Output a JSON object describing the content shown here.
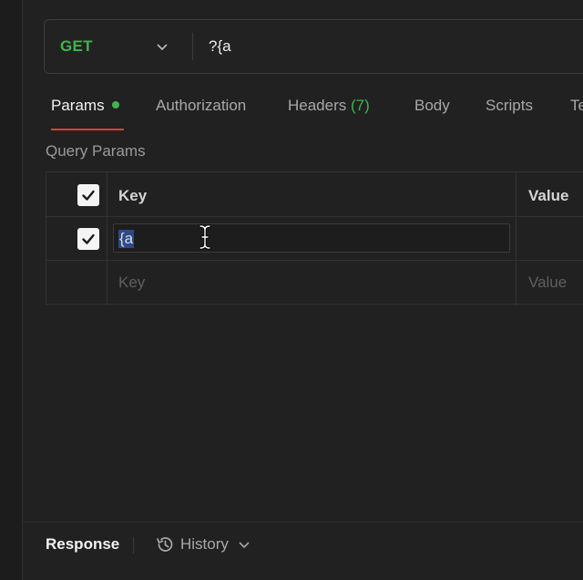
{
  "request": {
    "method": "GET",
    "url": "?{a"
  },
  "tabs": [
    {
      "label": "Params"
    },
    {
      "label": "Authorization"
    },
    {
      "label": "Headers",
      "count": "(7)"
    },
    {
      "label": "Body"
    },
    {
      "label": "Scripts"
    },
    {
      "label": "Te"
    }
  ],
  "query_params": {
    "title": "Query Params",
    "header": {
      "key": "Key",
      "value": "Value"
    },
    "rows": [
      {
        "checked": true,
        "key": "{a",
        "value": ""
      }
    ],
    "new_row": {
      "key_placeholder": "Key",
      "value_placeholder": "Value"
    }
  },
  "bottom": {
    "response_label": "Response",
    "history_label": "History"
  },
  "colors": {
    "accent_green": "#3fb54d",
    "active_tab_underline": "#d3452f",
    "selection": "#2d4a86"
  }
}
